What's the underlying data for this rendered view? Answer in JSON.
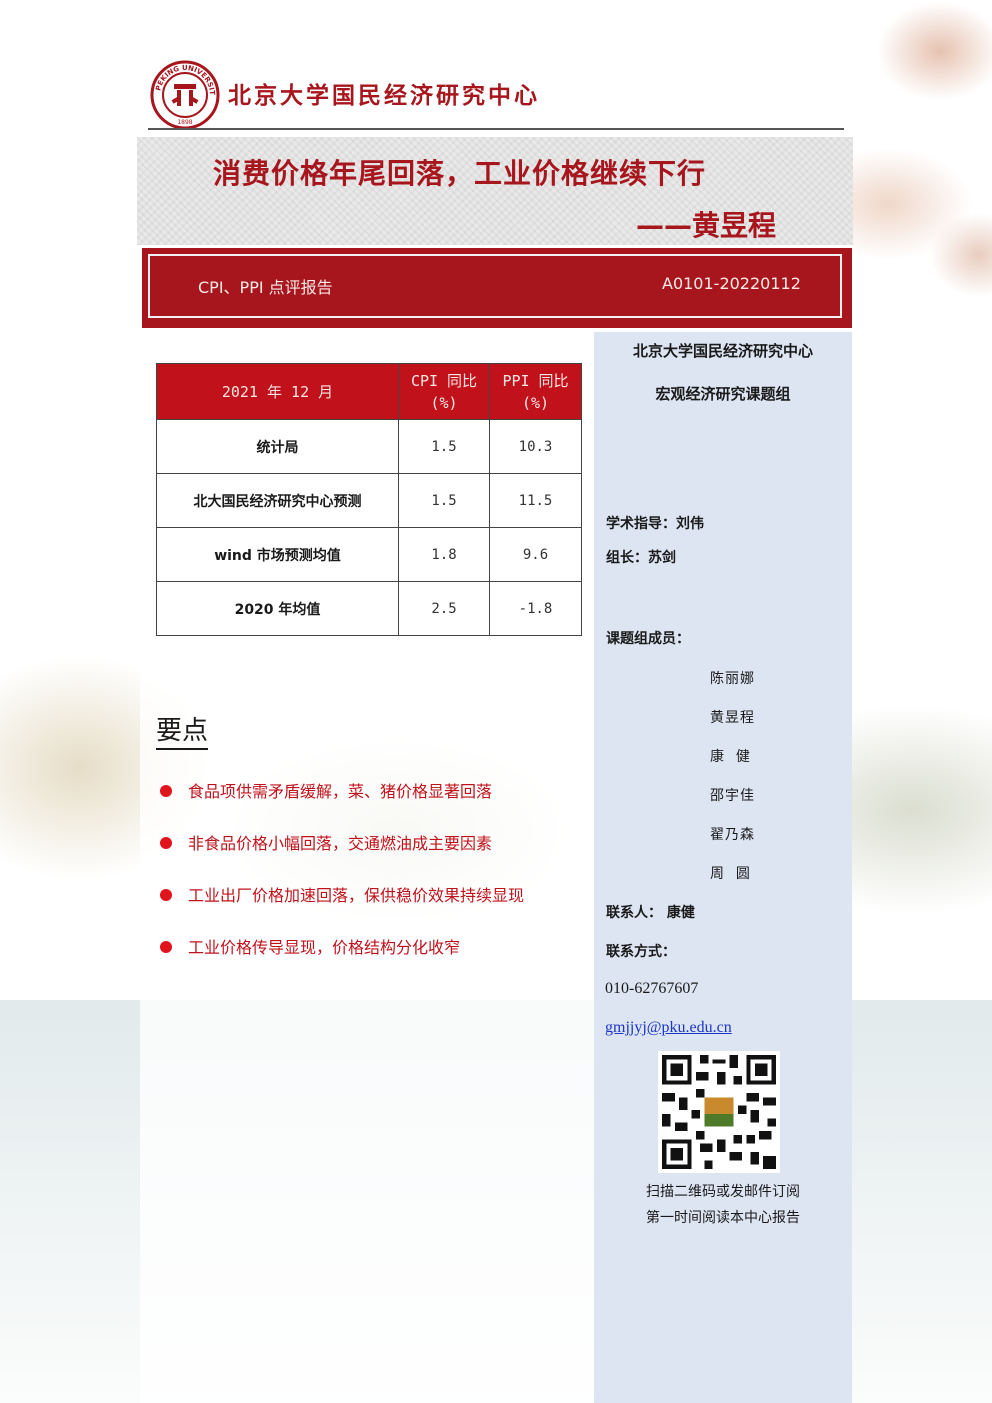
{
  "header": {
    "org_name": "北京大学国民经济研究中心",
    "logo_text": "PEKING UNIVERSITY 1898"
  },
  "title": {
    "main": "消费价格年尾回落，工业价格继续下行",
    "author": "——黄昱程"
  },
  "report_bar": {
    "type": "CPI、PPI 点评报告",
    "code": "A0101-20220112"
  },
  "table": {
    "headers": [
      "2021 年 12 月",
      "CPI 同比",
      "(%)",
      "PPI 同比",
      "(%)"
    ],
    "rows": [
      {
        "label": "统计局",
        "cpi": "1.5",
        "ppi": "10.3"
      },
      {
        "label": "北大国民经济研究中心预测",
        "cpi": "1.5",
        "ppi": "11.5"
      },
      {
        "label": "wind 市场预测均值",
        "cpi": "1.8",
        "ppi": "9.6"
      },
      {
        "label": "2020 年均值",
        "cpi": "2.5",
        "ppi": "-1.8"
      }
    ]
  },
  "key_points": {
    "heading": "要点",
    "items": [
      "食品项供需矛盾缓解，菜、猪价格显著回落",
      "非食品价格小幅回落，交通燃油成主要因素",
      "工业出厂价格加速回落，保供稳价效果持续显现",
      "工业价格传导显现，价格结构分化收窄"
    ]
  },
  "sidebar": {
    "org": "北京大学国民经济研究中心",
    "group": "宏观经济研究课题组",
    "advisor": "学术指导：刘伟",
    "leader": "组长：苏剑",
    "members_label": "课题组成员：",
    "members": [
      "陈丽娜",
      "黄昱程",
      "康  健",
      "邵宇佳",
      "翟乃森",
      "周  圆"
    ],
    "contact": "联系人： 康健",
    "contact_method": "联系方式：",
    "phone": "010-62767607",
    "email": "gmjjyj@pku.edu.cn",
    "scan_line1": "扫描二维码或发邮件订阅",
    "scan_line2": "第一时间阅读本中心报告"
  },
  "colors": {
    "brand_red": "#a8161d",
    "table_header_red": "#c1121c",
    "sidebar_blue": "#dde5f2"
  }
}
